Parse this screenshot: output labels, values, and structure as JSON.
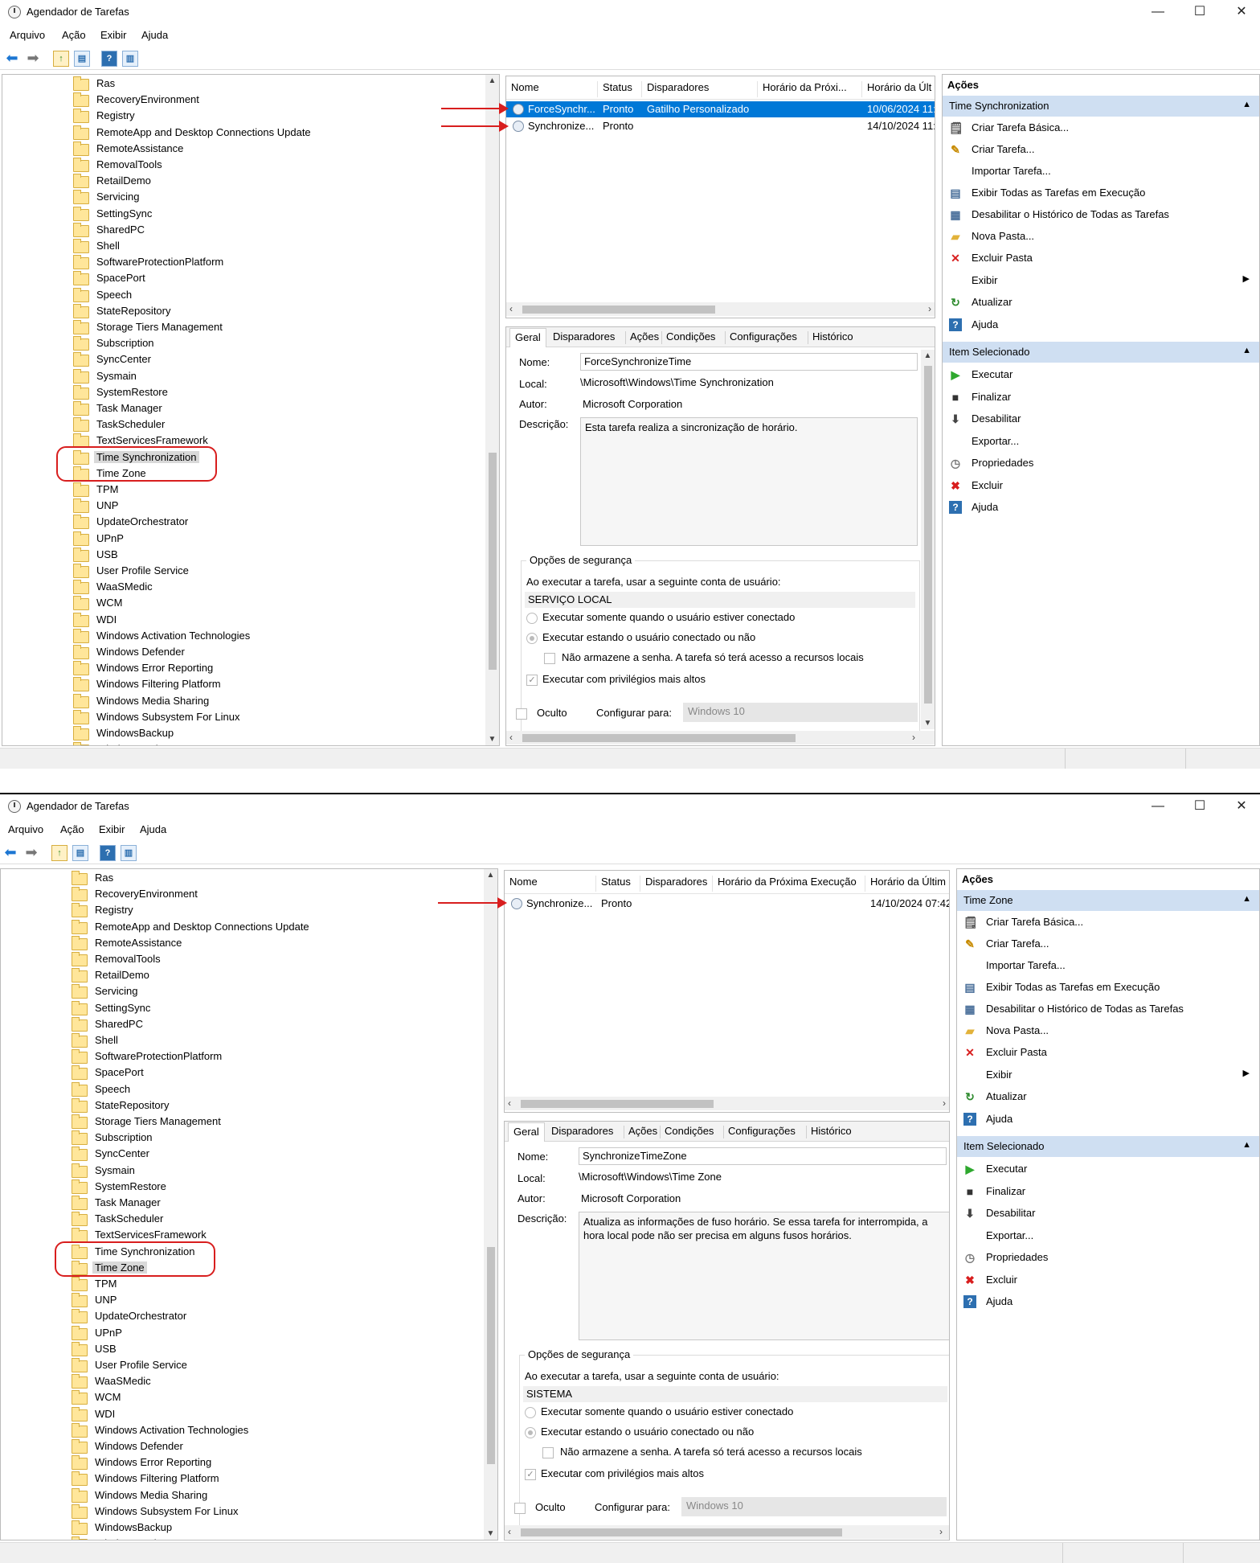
{
  "app": {
    "title": "Agendador de Tarefas"
  },
  "menu": [
    "Arquivo",
    "Ação",
    "Exibir",
    "Ajuda"
  ],
  "tree_items": [
    "Ras",
    "RecoveryEnvironment",
    "Registry",
    "RemoteApp and Desktop Connections Update",
    "RemoteAssistance",
    "RemovalTools",
    "RetailDemo",
    "Servicing",
    "SettingSync",
    "SharedPC",
    "Shell",
    "SoftwareProtectionPlatform",
    "SpacePort",
    "Speech",
    "StateRepository",
    "Storage Tiers Management",
    "Subscription",
    "SyncCenter",
    "Sysmain",
    "SystemRestore",
    "Task Manager",
    "TaskScheduler",
    "TextServicesFramework",
    "Time Synchronization",
    "Time Zone",
    "TPM",
    "UNP",
    "UpdateOrchestrator",
    "UPnP",
    "USB",
    "User Profile Service",
    "WaaSMedic",
    "WCM",
    "WDI",
    "Windows Activation Technologies",
    "Windows Defender",
    "Windows Error Reporting",
    "Windows Filtering Platform",
    "Windows Media Sharing",
    "Windows Subsystem For Linux",
    "WindowsBackup",
    "WindowsCodeSet"
  ],
  "tabs": [
    "Geral",
    "Disparadores",
    "Ações",
    "Condições",
    "Configurações",
    "Histórico"
  ],
  "detail_labels": {
    "name": "Nome:",
    "location": "Local:",
    "author": "Autor:",
    "description": "Descrição:",
    "security": "Opções de segurança",
    "run_as": "Ao executar a tarefa, usar a seguinte conta de usuário:",
    "only_logged": "Executar somente quando o usuário estiver conectado",
    "logged_or_not": "Executar estando o usuário conectado ou não",
    "no_password": "Não armazene a senha. A tarefa só terá acesso a recursos locais",
    "highest": "Executar com privilégios mais altos",
    "hidden": "Oculto",
    "configure_for": "Configurar para:",
    "configure_value": "Windows 10"
  },
  "actions": {
    "header": "Ações",
    "folder_items": [
      "Criar Tarefa Básica...",
      "Criar Tarefa...",
      "Importar Tarefa...",
      "Exibir Todas as Tarefas em Execução",
      "Desabilitar o Histórico de Todas as Tarefas",
      "Nova Pasta...",
      "Excluir Pasta",
      "Exibir",
      "Atualizar",
      "Ajuda"
    ],
    "selected_header": "Item Selecionado",
    "selected_items": [
      "Executar",
      "Finalizar",
      "Desabilitar",
      "Exportar...",
      "Propriedades",
      "Excluir",
      "Ajuda"
    ]
  },
  "window1": {
    "selected_folder": "Time Synchronization",
    "columns": [
      "Nome",
      "Status",
      "Disparadores",
      "Horário da Próxi...",
      "Horário da Últ"
    ],
    "rows": [
      {
        "name": "ForceSynchr...",
        "status": "Pronto",
        "trigger": "Gatilho Personalizado",
        "next": "",
        "last": "10/06/2024 11:"
      },
      {
        "name": "Synchronize...",
        "status": "Pronto",
        "trigger": "",
        "next": "",
        "last": "14/10/2024 11:"
      }
    ],
    "detail": {
      "name": "ForceSynchronizeTime",
      "location": "\\Microsoft\\Windows\\Time Synchronization",
      "author": "Microsoft Corporation",
      "description": "Esta tarefa realiza a sincronização de horário.",
      "account": "SERVIÇO LOCAL"
    }
  },
  "window2": {
    "selected_folder": "Time Zone",
    "columns": [
      "Nome",
      "Status",
      "Disparadores",
      "Horário da Próxima Execução",
      "Horário da Últim"
    ],
    "rows": [
      {
        "name": "Synchronize...",
        "status": "Pronto",
        "trigger": "",
        "next": "",
        "last": "14/10/2024 07:42"
      }
    ],
    "detail": {
      "name": "SynchronizeTimeZone",
      "location": "\\Microsoft\\Windows\\Time Zone",
      "author": "Microsoft Corporation",
      "description": "Atualiza as informações de fuso horário. Se essa tarefa for interrompida, a hora local pode não ser precisa em alguns fusos horários.",
      "account": "SISTEMA"
    }
  },
  "colors": {
    "accent": "#0078d7",
    "annotation": "#d81e1e",
    "section": "#cfdff2"
  }
}
